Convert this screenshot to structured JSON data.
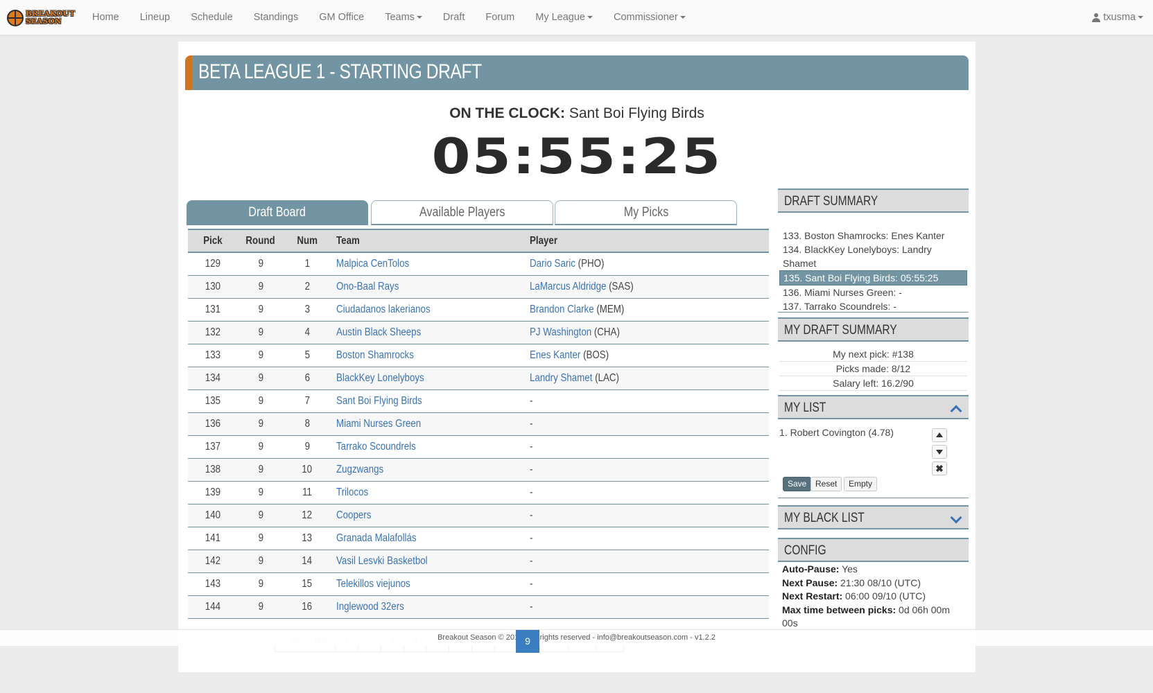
{
  "nav": {
    "logo_line1": "BREAKOUT",
    "logo_line2": "SEASON",
    "items": [
      {
        "label": "Home",
        "dropdown": false
      },
      {
        "label": "Lineup",
        "dropdown": false
      },
      {
        "label": "Schedule",
        "dropdown": false
      },
      {
        "label": "Standings",
        "dropdown": false
      },
      {
        "label": "GM Office",
        "dropdown": false
      },
      {
        "label": "Teams",
        "dropdown": true
      },
      {
        "label": "Draft",
        "dropdown": false
      },
      {
        "label": "Forum",
        "dropdown": false
      },
      {
        "label": "My League",
        "dropdown": true
      },
      {
        "label": "Commissioner",
        "dropdown": true
      }
    ],
    "user": "txusma"
  },
  "header": {
    "title": "BETA LEAGUE 1 - STARTING DRAFT"
  },
  "clock": {
    "label": "ON THE CLOCK:",
    "team": "Sant Boi Flying Birds",
    "time": "05:55:25"
  },
  "tabs": [
    {
      "label": "Draft Board",
      "active": true
    },
    {
      "label": "Available Players",
      "active": false
    },
    {
      "label": "My Picks",
      "active": false
    }
  ],
  "board": {
    "columns": [
      "Pick",
      "Round",
      "Num",
      "Team",
      "Player"
    ],
    "rows": [
      {
        "pick": "129",
        "round": "9",
        "num": "1",
        "team": "Malpica CenTolos",
        "player": "Dario Saric",
        "pos": " (PHO)"
      },
      {
        "pick": "130",
        "round": "9",
        "num": "2",
        "team": "Ono-Baal Rays",
        "player": "LaMarcus Aldridge",
        "pos": " (SAS)"
      },
      {
        "pick": "131",
        "round": "9",
        "num": "3",
        "team": "Ciudadanos lakerianos",
        "player": "Brandon Clarke",
        "pos": " (MEM)"
      },
      {
        "pick": "132",
        "round": "9",
        "num": "4",
        "team": "Austin Black Sheeps",
        "player": "PJ Washington",
        "pos": " (CHA)"
      },
      {
        "pick": "133",
        "round": "9",
        "num": "5",
        "team": "Boston Shamrocks",
        "player": "Enes Kanter",
        "pos": " (BOS)"
      },
      {
        "pick": "134",
        "round": "9",
        "num": "6",
        "team": "BlackKey Lonelyboys",
        "player": "Landry Shamet",
        "pos": " (LAC)"
      },
      {
        "pick": "135",
        "round": "9",
        "num": "7",
        "team": "Sant Boi Flying Birds",
        "player": "",
        "pos": "-"
      },
      {
        "pick": "136",
        "round": "9",
        "num": "8",
        "team": "Miami Nurses Green",
        "player": "",
        "pos": "-"
      },
      {
        "pick": "137",
        "round": "9",
        "num": "9",
        "team": "Tarrako Scoundrels",
        "player": "",
        "pos": "-"
      },
      {
        "pick": "138",
        "round": "9",
        "num": "10",
        "team": "Zugzwangs",
        "player": "",
        "pos": "-"
      },
      {
        "pick": "139",
        "round": "9",
        "num": "11",
        "team": "Trilocos",
        "player": "",
        "pos": "-"
      },
      {
        "pick": "140",
        "round": "9",
        "num": "12",
        "team": "Coopers",
        "player": "",
        "pos": "-"
      },
      {
        "pick": "141",
        "round": "9",
        "num": "13",
        "team": "Granada Malafollás",
        "player": "",
        "pos": "-"
      },
      {
        "pick": "142",
        "round": "9",
        "num": "14",
        "team": "Vasil Lesvki Basketbol",
        "player": "",
        "pos": "-"
      },
      {
        "pick": "143",
        "round": "9",
        "num": "15",
        "team": "Telekillos viejunos",
        "player": "",
        "pos": "-"
      },
      {
        "pick": "144",
        "round": "9",
        "num": "16",
        "team": "Inglewood 32ers",
        "player": "",
        "pos": "-"
      }
    ]
  },
  "draft_summary": {
    "title": "DRAFT SUMMARY",
    "items": [
      {
        "text": "133. Boston Shamrocks: Enes Kanter",
        "current": false
      },
      {
        "text": "134. BlackKey Lonelyboys: Landry Shamet",
        "current": false
      },
      {
        "text": "135. Sant Boi Flying Birds: 05:55:25",
        "current": true
      },
      {
        "text": "136. Miami Nurses Green: -",
        "current": false
      },
      {
        "text": "137. Tarrako Scoundrels: -",
        "current": false
      }
    ]
  },
  "my_draft_summary": {
    "title": "MY DRAFT SUMMARY",
    "next_pick": "My next pick: #138",
    "picks_made": "Picks made: 8/12",
    "salary_left": "Salary left: 16.2/90"
  },
  "my_list": {
    "title": "MY LIST",
    "items": [
      "1. Robert Covington (4.78)"
    ],
    "move_up_glyph": "▲",
    "move_down_glyph": "▼",
    "remove_glyph": "✖",
    "save_label": "Save",
    "reset_label": "Reset",
    "empty_label": "Empty"
  },
  "my_black_list": {
    "title": "MY BLACK LIST"
  },
  "config": {
    "title": "CONFIG",
    "auto_pause_label": "Auto-Pause:",
    "auto_pause_value": " Yes",
    "next_pause_label": "Next Pause:",
    "next_pause_value": " 21:30 08/10 (UTC)",
    "next_restart_label": "Next Restart:",
    "next_restart_value": " 06:00 09/10 (UTC)",
    "max_time_label": "Max time between picks:",
    "max_time_value": " 0d 06h 00m 00s"
  },
  "pagination": {
    "prev_label": "« Prev Rd",
    "pages": [
      "1",
      "2",
      "3",
      "4",
      "5",
      "6",
      "7",
      "8",
      "9",
      "10",
      "11",
      "12"
    ],
    "current": "9"
  },
  "footer": {
    "text": "Breakout Season © 2019 · All rights reserved - info@breakoutseason.com - v1.2.2"
  }
}
